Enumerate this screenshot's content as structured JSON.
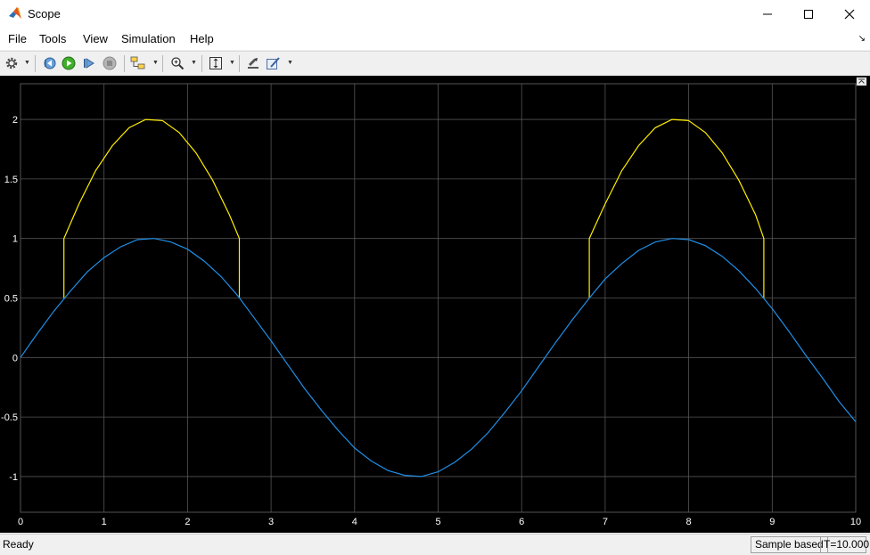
{
  "window": {
    "title": "Scope"
  },
  "menu": [
    "File",
    "Tools",
    "View",
    "Simulation",
    "Help"
  ],
  "toolbar": {
    "icons": [
      "gear-icon",
      "step-back-icon",
      "run-icon",
      "step-forward-icon",
      "stop-icon",
      "highlight-simulink-block-icon",
      "zoom-icon",
      "scale-axes-icon",
      "bring-to-front-icon",
      "style-icon"
    ]
  },
  "status": {
    "state": "Ready",
    "mode": "Sample based",
    "time": "T=10.000"
  },
  "colors": {
    "background": "#000000",
    "grid": "#555555",
    "axis_text": "#ffffff",
    "series1": "#ffee00",
    "series2": "#1f8fe8"
  },
  "chart_data": {
    "type": "line",
    "title": "",
    "xlabel": "",
    "ylabel": "",
    "xlim": [
      0,
      10
    ],
    "ylim": [
      -1.3,
      2.3
    ],
    "grid": true,
    "xticks": [
      "0",
      "1",
      "2",
      "3",
      "4",
      "5",
      "6",
      "7",
      "8",
      "9",
      "10"
    ],
    "yticks": [
      "-1",
      "-0.5",
      "0",
      "0.5",
      "1",
      "1.5",
      "2"
    ],
    "series": [
      {
        "color": "#ffee00",
        "points": [
          [
            0.52,
            0.5
          ],
          [
            0.52,
            1.0
          ],
          [
            0.7,
            1.29
          ],
          [
            0.9,
            1.57
          ],
          [
            1.1,
            1.78
          ],
          [
            1.3,
            1.93
          ],
          [
            1.5,
            2.0
          ],
          [
            1.7,
            1.99
          ],
          [
            1.9,
            1.89
          ],
          [
            2.1,
            1.72
          ],
          [
            2.3,
            1.49
          ],
          [
            2.5,
            1.2
          ],
          [
            2.62,
            1.0
          ],
          [
            2.62,
            0.5
          ]
        ]
      },
      {
        "color": "#ffee00",
        "points": [
          [
            6.81,
            0.5
          ],
          [
            6.81,
            1.0
          ],
          [
            7.0,
            1.29
          ],
          [
            7.2,
            1.57
          ],
          [
            7.4,
            1.78
          ],
          [
            7.6,
            1.93
          ],
          [
            7.8,
            2.0
          ],
          [
            8.0,
            1.99
          ],
          [
            8.2,
            1.89
          ],
          [
            8.4,
            1.72
          ],
          [
            8.6,
            1.49
          ],
          [
            8.8,
            1.2
          ],
          [
            8.9,
            1.0
          ],
          [
            8.9,
            0.5
          ]
        ]
      },
      {
        "color": "#1f8fe8",
        "points": [
          [
            0,
            0
          ],
          [
            0.2,
            0.2
          ],
          [
            0.4,
            0.39
          ],
          [
            0.6,
            0.56
          ],
          [
            0.8,
            0.72
          ],
          [
            1.0,
            0.84
          ],
          [
            1.2,
            0.93
          ],
          [
            1.4,
            0.99
          ],
          [
            1.6,
            1.0
          ],
          [
            1.8,
            0.97
          ],
          [
            2.0,
            0.91
          ],
          [
            2.2,
            0.81
          ],
          [
            2.4,
            0.68
          ],
          [
            2.6,
            0.52
          ],
          [
            2.8,
            0.33
          ],
          [
            3.0,
            0.14
          ],
          [
            3.2,
            -0.06
          ],
          [
            3.4,
            -0.26
          ],
          [
            3.6,
            -0.44
          ],
          [
            3.8,
            -0.61
          ],
          [
            4.0,
            -0.76
          ],
          [
            4.2,
            -0.87
          ],
          [
            4.4,
            -0.95
          ],
          [
            4.6,
            -0.99
          ],
          [
            4.8,
            -1.0
          ],
          [
            5.0,
            -0.96
          ],
          [
            5.2,
            -0.88
          ],
          [
            5.4,
            -0.77
          ],
          [
            5.6,
            -0.63
          ],
          [
            5.8,
            -0.46
          ],
          [
            6.0,
            -0.28
          ],
          [
            6.2,
            -0.08
          ],
          [
            6.4,
            0.12
          ],
          [
            6.6,
            0.31
          ],
          [
            6.8,
            0.49
          ],
          [
            7.0,
            0.66
          ],
          [
            7.2,
            0.79
          ],
          [
            7.4,
            0.9
          ],
          [
            7.6,
            0.97
          ],
          [
            7.8,
            1.0
          ],
          [
            8.0,
            0.99
          ],
          [
            8.2,
            0.94
          ],
          [
            8.4,
            0.85
          ],
          [
            8.6,
            0.73
          ],
          [
            8.8,
            0.58
          ],
          [
            9.0,
            0.41
          ],
          [
            9.2,
            0.22
          ],
          [
            9.4,
            0.02
          ],
          [
            9.6,
            -0.17
          ],
          [
            9.8,
            -0.37
          ],
          [
            10.0,
            -0.54
          ]
        ]
      }
    ]
  }
}
